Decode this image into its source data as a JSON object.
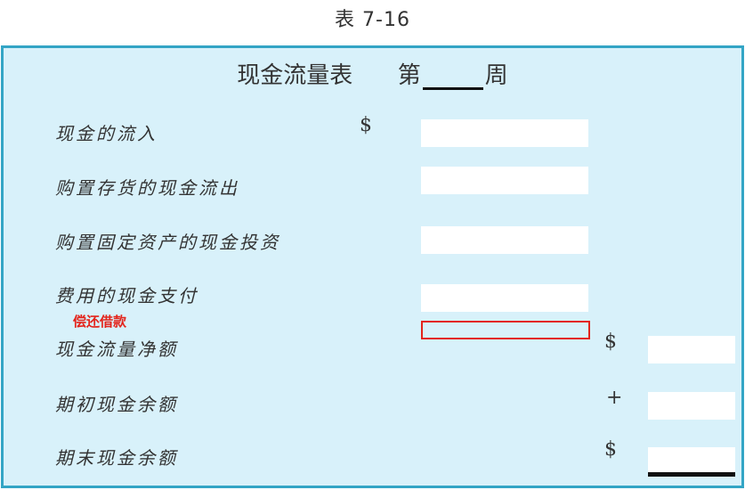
{
  "caption": "表 7-16",
  "statement": {
    "title_prefix": "现金流量表",
    "title_week_prefix": "第",
    "title_week_suffix": "周",
    "currency_symbol": "$",
    "plus_symbol": "+",
    "note": "偿还借款",
    "rows": [
      "现金的流入",
      "购置存货的现金流出",
      "购置固定资产的现金投资",
      "费用的现金支付",
      "现金流量净额",
      "期初现金余额",
      "期末现金余额"
    ]
  },
  "colors": {
    "background": "#d8f1fa",
    "border": "#33a5c5",
    "note": "#e3241b"
  }
}
